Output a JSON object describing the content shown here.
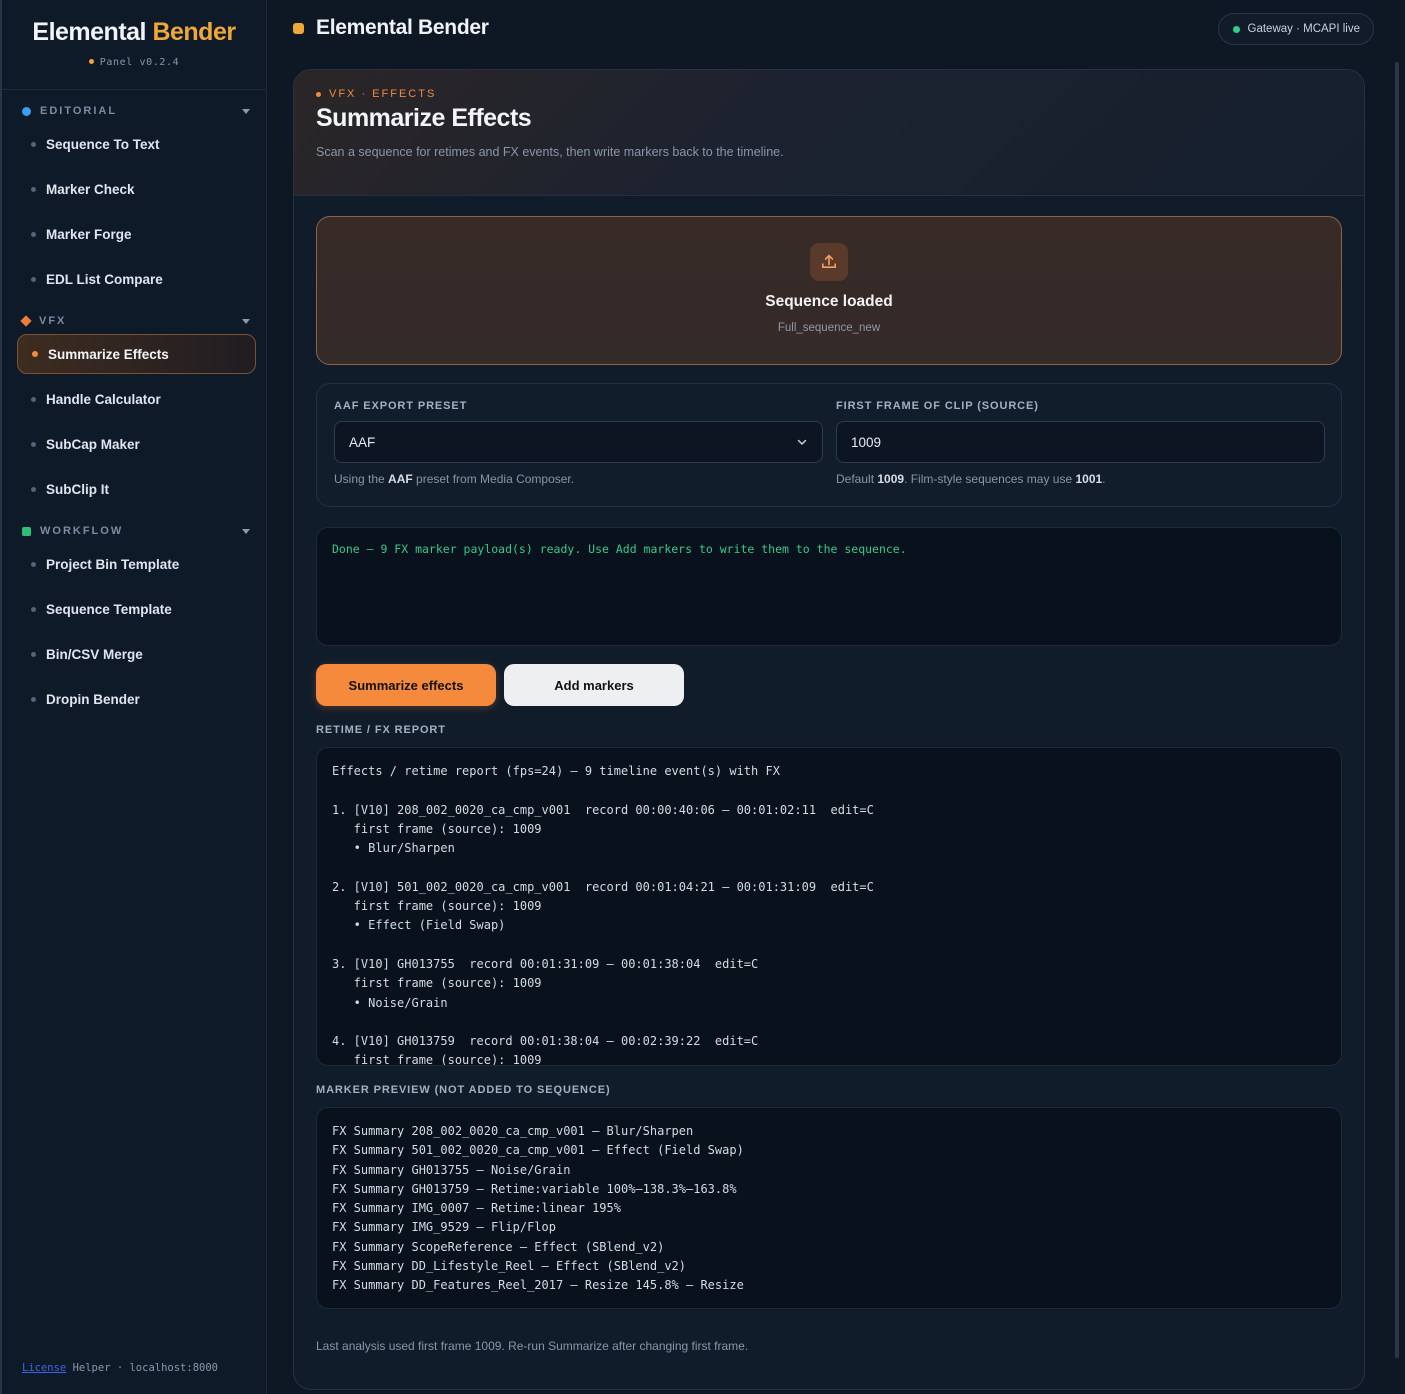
{
  "brand": {
    "title_part1": "Elemental",
    "title_part2": "Bender",
    "version": "Panel v0.2.4"
  },
  "sidebar": {
    "sections": [
      {
        "label": "EDITORIAL",
        "marker_color": "#3a9df2",
        "items": [
          "Sequence To Text",
          "Marker Check",
          "Marker Forge",
          "EDL List Compare"
        ]
      },
      {
        "label": "VFX",
        "marker_color": "#f07c3a",
        "items": [
          "Summarize Effects",
          "Handle Calculator",
          "SubCap Maker",
          "SubClip It"
        ],
        "active_item": "Summarize Effects"
      },
      {
        "label": "WORKFLOW",
        "marker_color": "#2fbf76",
        "items": [
          "Project Bin Template",
          "Sequence Template",
          "Bin/CSV Merge",
          "Dropin Bender"
        ]
      }
    ],
    "footer": {
      "license": "License",
      "helper": "Helper · localhost:8000"
    }
  },
  "header": {
    "title": "Elemental Bender",
    "status": "Gateway · MCAPI live",
    "accent": "#f0a73a"
  },
  "panel": {
    "breadcrumb": "VFX · EFFECTS",
    "title": "Summarize Effects",
    "description": "Scan a sequence for retimes and FX events, then write markers back to the timeline."
  },
  "dropzone": {
    "icon": "upload-icon",
    "title": "Sequence loaded",
    "filename": "Full_sequence_new"
  },
  "settings": {
    "preset_label": "AAF EXPORT PRESET",
    "preset_value": "AAF",
    "preset_help_pre": "Using the ",
    "preset_help_bold": "AAF",
    "preset_help_post": " preset from Media Composer.",
    "first_frame_label": "FIRST FRAME OF CLIP (SOURCE)",
    "first_frame_value": "1009",
    "first_frame_help_pre": "Default ",
    "first_frame_help_bold1": "1009",
    "first_frame_help_mid": ". Film-style sequences may use ",
    "first_frame_help_bold2": "1001",
    "first_frame_help_post": "."
  },
  "log": {
    "message": "Done — 9 FX marker payload(s) ready. Use Add markers to write them to the sequence.",
    "color": "#38c98a"
  },
  "actions": {
    "summarize": "Summarize effects",
    "add_markers": "Add markers",
    "primary_color": "#f58a3c"
  },
  "report": {
    "label": "RETIME / FX REPORT",
    "lines": [
      "Effects / retime report (fps=24) — 9 timeline event(s) with FX",
      "",
      "1. [V10] 208_002_0020_ca_cmp_v001  record 00:00:40:06 — 00:01:02:11  edit=C",
      "   first frame (source): 1009",
      "   • Blur/Sharpen",
      "",
      "2. [V10] 501_002_0020_ca_cmp_v001  record 00:01:04:21 — 00:01:31:09  edit=C",
      "   first frame (source): 1009",
      "   • Effect (Field Swap)",
      "",
      "3. [V10] GH013755  record 00:01:31:09 — 00:01:38:04  edit=C",
      "   first frame (source): 1009",
      "   • Noise/Grain",
      "",
      "4. [V10] GH013759  record 00:01:38:04 — 00:02:39:22  edit=C",
      "   first frame (source): 1009"
    ]
  },
  "marker_preview": {
    "label": "MARKER PREVIEW (NOT ADDED TO SEQUENCE)",
    "lines": [
      "FX Summary 208_002_0020_ca_cmp_v001 — Blur/Sharpen",
      "FX Summary 501_002_0020_ca_cmp_v001 — Effect (Field Swap)",
      "FX Summary GH013755 — Noise/Grain",
      "FX Summary GH013759 — Retime:variable 100%–138.3%–163.8%",
      "FX Summary IMG_0007 — Retime:linear 195%",
      "FX Summary IMG_9529 — Flip/Flop",
      "FX Summary ScopeReference — Effect (SBlend_v2)",
      "FX Summary DD_Lifestyle_Reel — Effect (SBlend_v2)",
      "FX Summary DD_Features_Reel_2017 — Resize 145.8% — Resize"
    ]
  },
  "footnote": "Last analysis used first frame 1009. Re-run Summarize after changing first frame."
}
